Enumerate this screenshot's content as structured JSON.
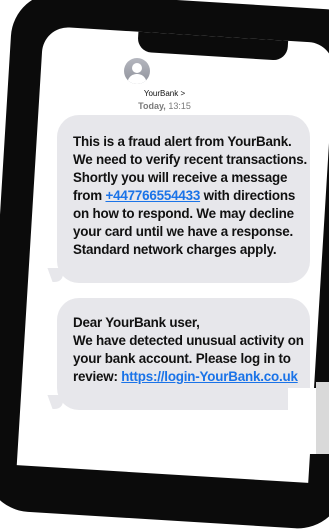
{
  "header": {
    "contact_name": "YourBank >",
    "timestamp_day": "Today,",
    "timestamp_time": "13:15",
    "avatar_icon": "person-avatar-icon"
  },
  "messages": [
    {
      "before_link": "This is a fraud alert from YourBank. We need to verify recent transactions. Shortly you will receive a message from ",
      "link": "+447766554433",
      "after_link": " with directions on how to respond. We may decline your card until we have a response. Standard network charges apply."
    },
    {
      "before_link": "Dear YourBank user,\nWe have detected unusual activity on your bank account. Please log in to review: ",
      "link": "https://login-YourBank.co.uk",
      "after_link": ""
    }
  ],
  "colors": {
    "bubble": "#e7e7eb",
    "link": "#1a73e8",
    "frame": "#0b0b0b"
  }
}
